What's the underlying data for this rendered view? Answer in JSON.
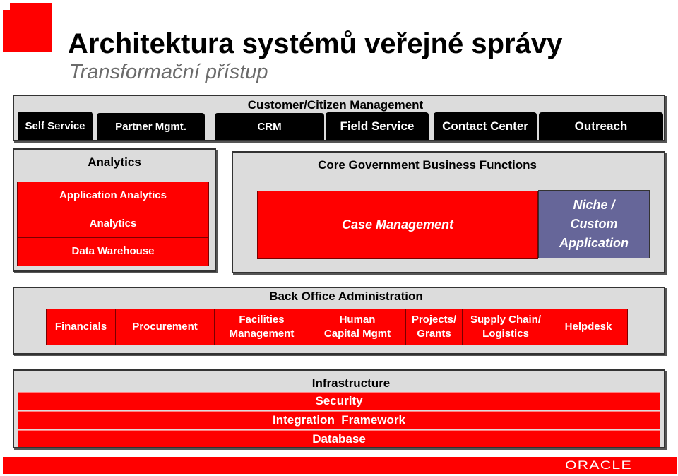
{
  "header": {
    "title": "Architektura systémů veřejné správy",
    "subtitle": "Transformační přístup"
  },
  "customer": {
    "label": "Customer/Citizen Management",
    "tabs": [
      "Self Service",
      "Partner Mgmt.",
      "CRM",
      "Field Service",
      "Contact Center",
      "Outreach"
    ]
  },
  "analytics": {
    "label": "Analytics",
    "items": [
      "Application Analytics",
      "Analytics",
      "Data Warehouse"
    ]
  },
  "core": {
    "label": "Core Government Business Functions",
    "case_management": "Case Management",
    "niche": [
      "Niche /",
      "Custom",
      "Application"
    ]
  },
  "back_office": {
    "label": "Back Office Administration",
    "items": [
      {
        "line1": "Financials",
        "line2": ""
      },
      {
        "line1": "Procurement",
        "line2": ""
      },
      {
        "line1": "Facilities",
        "line2": "Management"
      },
      {
        "line1": "Human",
        "line2": "Capital Mgmt"
      },
      {
        "line1": "Projects/",
        "line2": "Grants"
      },
      {
        "line1": "Supply Chain/",
        "line2": "Logistics"
      },
      {
        "line1": "Helpdesk",
        "line2": ""
      }
    ]
  },
  "infrastructure": {
    "label": "Infrastructure",
    "layers": [
      "Security",
      "Integration  Framework",
      "Database"
    ]
  },
  "footer": {
    "brand": "ORACLE"
  },
  "colors": {
    "accent_red": "#ff0000",
    "niche_purple": "#666699",
    "panel_gray": "#dcdcdc",
    "tab_black": "#000000"
  }
}
